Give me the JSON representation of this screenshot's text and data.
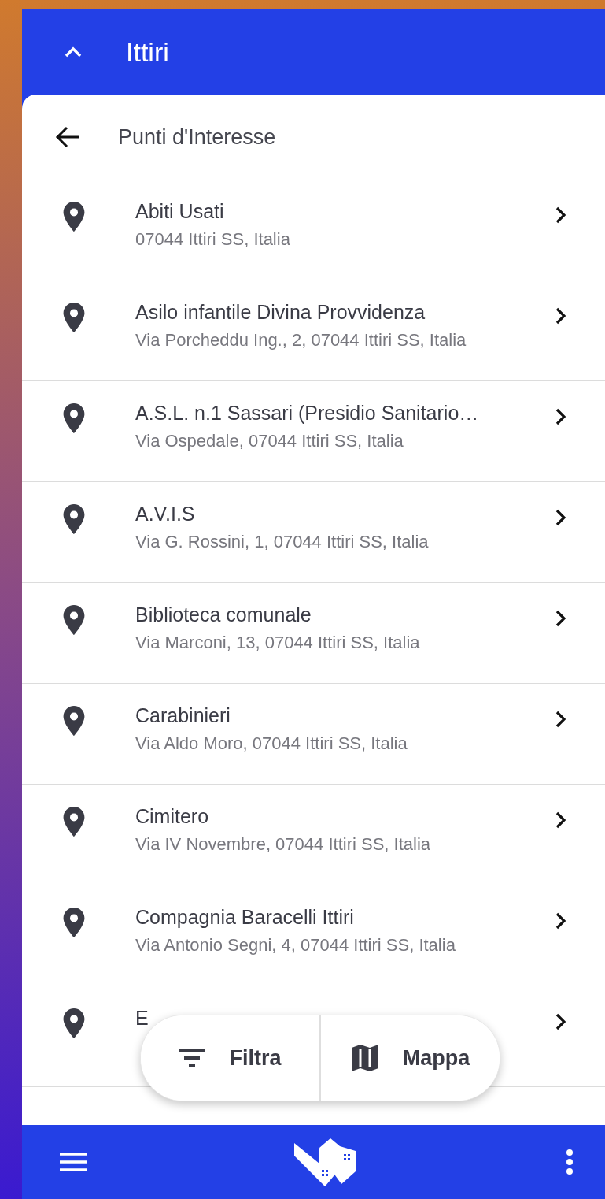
{
  "header": {
    "title": "Ittiri"
  },
  "section": {
    "title": "Punti d'Interesse"
  },
  "places": [
    {
      "name": "Abiti Usati",
      "address": "07044 Ittiri SS, Italia"
    },
    {
      "name": "Asilo infantile Divina Provvidenza",
      "address": "Via Porcheddu Ing., 2, 07044 Ittiri SS, Italia"
    },
    {
      "name": "A.S.L. n.1 Sassari (Presidio Sanitario…",
      "address": "Via Ospedale, 07044 Ittiri SS, Italia"
    },
    {
      "name": "A.V.I.S",
      "address": "Via G. Rossini, 1, 07044 Ittiri SS, Italia"
    },
    {
      "name": "Biblioteca comunale",
      "address": "Via Marconi, 13, 07044 Ittiri SS, Italia"
    },
    {
      "name": "Carabinieri",
      "address": "Via Aldo Moro, 07044 Ittiri SS, Italia"
    },
    {
      "name": "Cimitero",
      "address": "Via IV Novembre, 07044 Ittiri SS, Italia"
    },
    {
      "name": "Compagnia Baracelli Ittiri",
      "address": "Via Antonio Segni, 4, 07044 Ittiri SS, Italia"
    },
    {
      "name": "E"
    }
  ],
  "floating_actions": [
    {
      "kind": "filter",
      "label": "Filtra"
    },
    {
      "kind": "map",
      "label": "Mappa"
    }
  ]
}
